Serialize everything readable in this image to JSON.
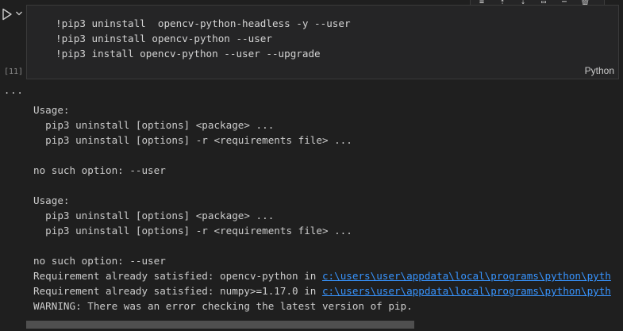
{
  "toolbar": {
    "icons": [
      "run-by-line-icon",
      "execute-above-icon",
      "execute-below-icon",
      "split-cell-icon",
      "more-icon",
      "delete-icon"
    ]
  },
  "cell": {
    "execution_count": "[11]",
    "language": "Python",
    "code_lines": [
      "!pip3 uninstall  opencv-python-headless -y --user",
      "!pip3 uninstall opencv-python --user",
      "!pip3 install opencv-python --user --upgrade"
    ]
  },
  "output": {
    "menu": "...",
    "lines": [
      {
        "text": "Usage:"
      },
      {
        "text": "  pip3 uninstall [options] <package> ..."
      },
      {
        "text": "  pip3 uninstall [options] -r <requirements file> ..."
      },
      {
        "text": ""
      },
      {
        "text": "no such option: --user"
      },
      {
        "text": ""
      },
      {
        "text": "Usage:"
      },
      {
        "text": "  pip3 uninstall [options] <package> ..."
      },
      {
        "text": "  pip3 uninstall [options] -r <requirements file> ..."
      },
      {
        "text": ""
      },
      {
        "text": "no such option: --user"
      },
      {
        "text": "Requirement already satisfied: opencv-python in ",
        "link": "c:\\users\\user\\appdata\\local\\programs\\python\\pyth"
      },
      {
        "text": "Requirement already satisfied: numpy>=1.17.0 in ",
        "link": "c:\\users\\user\\appdata\\local\\programs\\python\\pyth"
      },
      {
        "text": "WARNING: There was an error checking the latest version of pip."
      }
    ]
  },
  "scrollbar": {
    "horizontal_thumb_fraction": 0.65
  }
}
